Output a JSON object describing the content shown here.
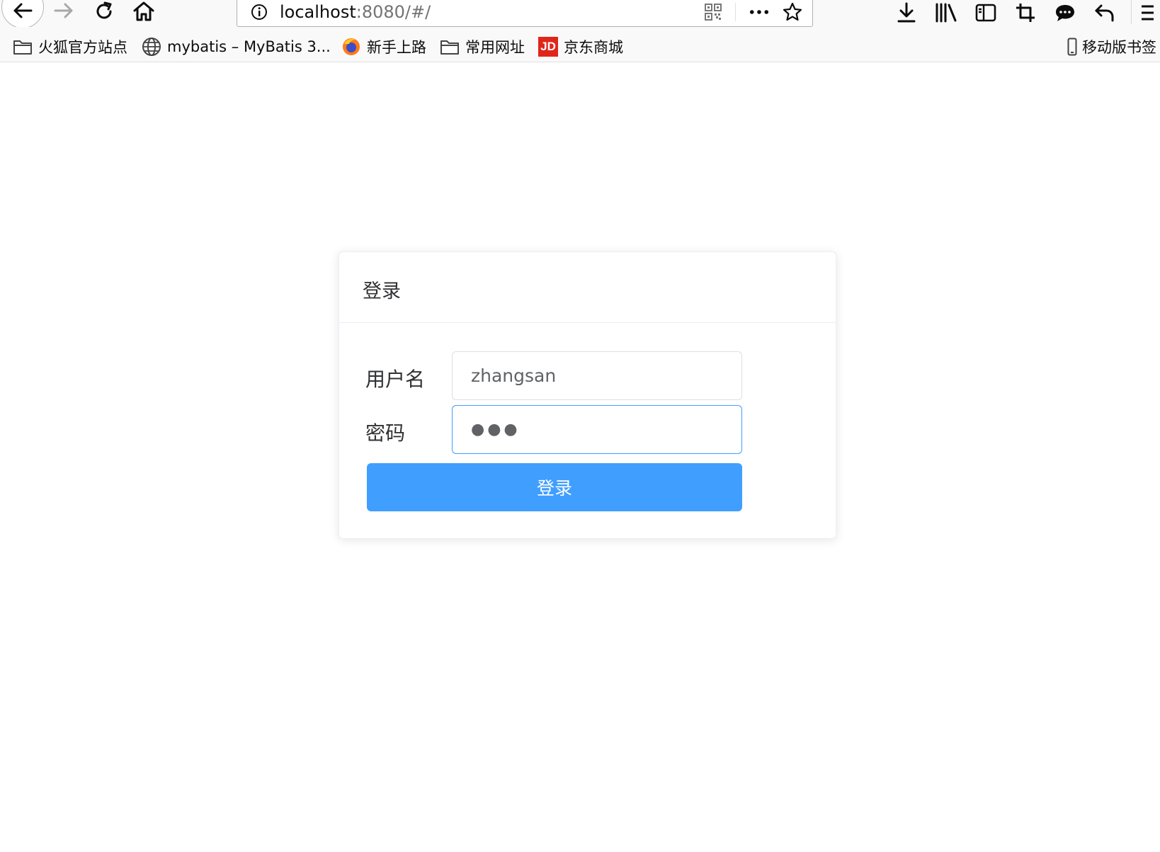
{
  "browser": {
    "url_host": "localhost",
    "url_rest": ":8080/#/",
    "icons": [
      "back-icon",
      "forward-icon",
      "reload-icon",
      "home-icon",
      "info-icon",
      "qr-code-icon",
      "more-icon",
      "bookmark-star-icon",
      "download-icon",
      "library-icon",
      "sidebar-icon",
      "screenshot-icon",
      "chat-icon",
      "undo-icon",
      "menu-icon"
    ]
  },
  "bookmarks": [
    {
      "label": "火狐官方站点",
      "icon": "folder-icon"
    },
    {
      "label": "mybatis – MyBatis 3...",
      "icon": "globe-icon"
    },
    {
      "label": "新手上路",
      "icon": "firefox-icon"
    },
    {
      "label": "常用网址",
      "icon": "folder-icon"
    },
    {
      "label": "京东商城",
      "icon": "jd-icon",
      "badge": "JD"
    },
    {
      "label": "移动版书签",
      "icon": "mobile-icon"
    }
  ],
  "login": {
    "title": "登录",
    "username_label": "用户名",
    "username_value": "zhangsan",
    "password_label": "密码",
    "password_mask": "●●●",
    "submit_label": "登录"
  },
  "colors": {
    "primary": "#409eff",
    "border": "#dcdfe6",
    "text": "#303133"
  }
}
